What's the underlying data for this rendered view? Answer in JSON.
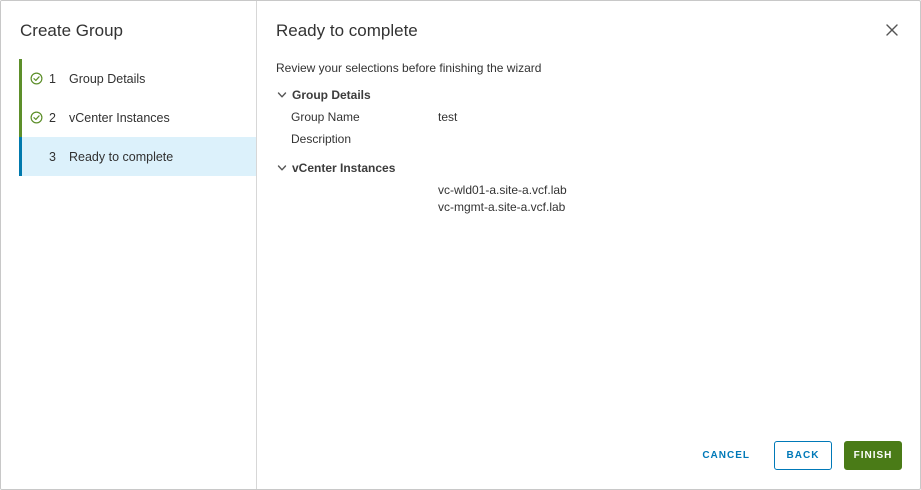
{
  "sidebar": {
    "title": "Create Group",
    "steps": [
      {
        "number": "1",
        "label": "Group Details",
        "status": "complete",
        "icon": "check-circle-icon"
      },
      {
        "number": "2",
        "label": "vCenter Instances",
        "status": "complete",
        "icon": "check-circle-icon"
      },
      {
        "number": "3",
        "label": "Ready to complete",
        "status": "current"
      }
    ]
  },
  "main": {
    "title": "Ready to complete",
    "intro": "Review your selections before finishing the wizard",
    "sections": {
      "group_details": {
        "header": "Group Details",
        "fields": [
          {
            "label": "Group Name",
            "value": "test"
          },
          {
            "label": "Description",
            "value": ""
          }
        ]
      },
      "vcenter_instances": {
        "header": "vCenter Instances",
        "values": [
          "vc-wld01-a.site-a.vcf.lab",
          "vc-mgmt-a.site-a.vcf.lab"
        ]
      }
    }
  },
  "footer": {
    "cancel_label": "CANCEL",
    "back_label": "BACK",
    "finish_label": "FINISH"
  },
  "colors": {
    "complete_accent": "#5d8f2a",
    "current_accent": "#0079ad",
    "current_background": "#dcf1fb",
    "link_blue": "#0079b8",
    "primary_green": "#4a7b17"
  }
}
